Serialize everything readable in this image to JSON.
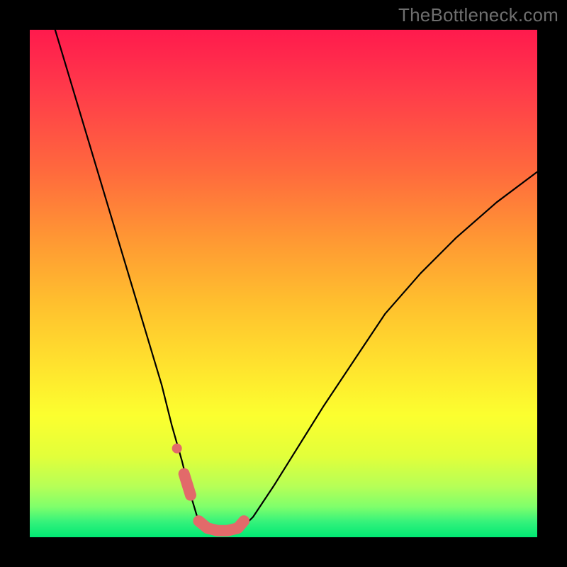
{
  "watermark": "TheBottleneck.com",
  "chart_data": {
    "type": "line",
    "title": "",
    "xlabel": "",
    "ylabel": "",
    "xlim": [
      0,
      100
    ],
    "ylim": [
      0,
      100
    ],
    "grid": false,
    "legend": false,
    "series": [
      {
        "name": "curve-left-branch",
        "color": "#000000",
        "x": [
          5,
          8,
          11,
          14,
          17,
          20,
          23,
          26,
          28,
          30,
          31.5,
          33,
          34.2
        ],
        "y": [
          100,
          90,
          80,
          70,
          60,
          50,
          40,
          30,
          22,
          15,
          9,
          4,
          1.5
        ]
      },
      {
        "name": "curve-floor",
        "color": "#000000",
        "x": [
          34.2,
          36,
          38,
          40,
          41.5
        ],
        "y": [
          1.5,
          1.0,
          1.0,
          1.0,
          1.5
        ]
      },
      {
        "name": "curve-right-branch",
        "color": "#000000",
        "x": [
          41.5,
          44,
          48,
          53,
          58,
          64,
          70,
          77,
          84,
          92,
          100
        ],
        "y": [
          1.5,
          4,
          10,
          18,
          26,
          35,
          44,
          52,
          59,
          66,
          72
        ]
      },
      {
        "name": "salmon-overlay-floor",
        "color": "#e26a6a",
        "stroke_width": 16,
        "x": [
          33.3,
          35,
          37,
          39,
          41,
          42.2
        ],
        "y": [
          3.2,
          1.8,
          1.3,
          1.3,
          1.8,
          3.2
        ]
      },
      {
        "name": "salmon-overlay-left-tick",
        "color": "#e26a6a",
        "stroke_width": 16,
        "x": [
          30.4,
          31.7
        ],
        "y": [
          12.5,
          8.3
        ]
      },
      {
        "name": "salmon-overlay-left-dot",
        "color": "#e26a6a",
        "type_hint": "dot",
        "x": [
          29.0
        ],
        "y": [
          17.5
        ]
      }
    ],
    "background_gradient": {
      "top_color": "#ff1a4d",
      "bottom_color": "#00e873",
      "orientation": "vertical"
    }
  }
}
